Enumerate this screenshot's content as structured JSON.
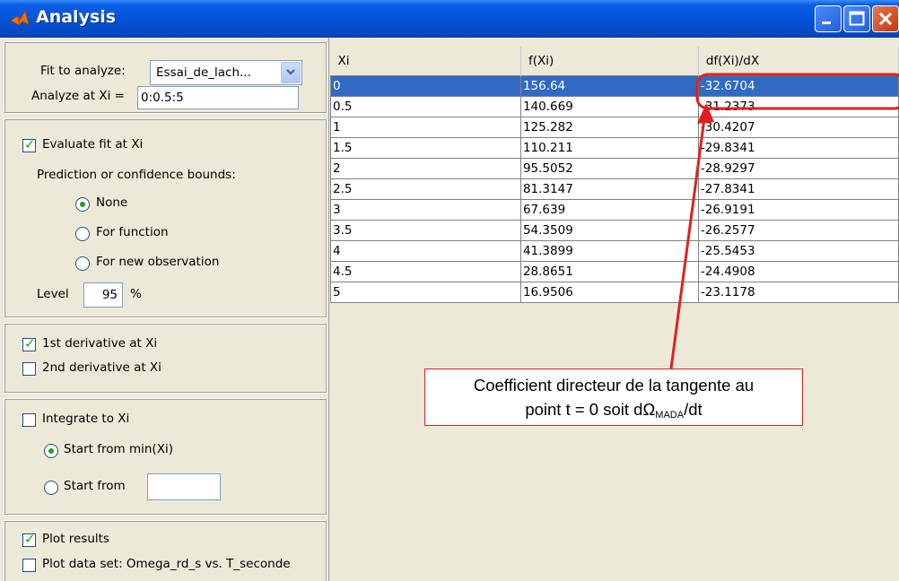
{
  "window": {
    "title": "Analysis"
  },
  "fit": {
    "fit_label": "Fit to analyze:",
    "fit_value": "Essai_de_lach...",
    "analyze_label": "Analyze at Xi =",
    "analyze_value": "0:0.5:5"
  },
  "evaluate": {
    "evaluate_label": "Evaluate fit at Xi",
    "evaluate_checked": true,
    "bounds_label": "Prediction or confidence bounds:",
    "options": [
      "None",
      "For function",
      "For new observation"
    ],
    "selected_option": "None",
    "level_label": "Level",
    "level_value": "95",
    "level_unit": "%"
  },
  "derivatives": {
    "first_label": "1st derivative at Xi",
    "first_checked": true,
    "second_label": "2nd derivative at Xi",
    "second_checked": false
  },
  "integrate": {
    "integrate_label": "Integrate to Xi",
    "integrate_checked": false,
    "start_min_label": "Start from min(Xi)",
    "start_from_label": "Start from",
    "start_from_value": ""
  },
  "plot": {
    "plot_results_label": "Plot results",
    "plot_results_checked": true,
    "plot_data_label": "Plot data set: Omega_rd_s vs. T_seconde",
    "plot_data_checked": false
  },
  "table": {
    "headers": [
      "Xi",
      "f(Xi)",
      "df(Xi)/dX"
    ],
    "rows": [
      [
        "0",
        "156.64",
        "-32.6704"
      ],
      [
        "0.5",
        "140.669",
        "-31.2373"
      ],
      [
        "1",
        "125.282",
        "-30.4207"
      ],
      [
        "1.5",
        "110.211",
        "-29.8341"
      ],
      [
        "2",
        "95.5052",
        "-28.9297"
      ],
      [
        "2.5",
        "81.3147",
        "-27.8341"
      ],
      [
        "3",
        "67.639",
        "-26.9191"
      ],
      [
        "3.5",
        "54.3509",
        "-26.2577"
      ],
      [
        "4",
        "41.3899",
        "-25.5453"
      ],
      [
        "4.5",
        "28.8651",
        "-24.4908"
      ],
      [
        "5",
        "16.9506",
        "-23.1178"
      ]
    ],
    "selected_row": 0
  },
  "annotation": {
    "line1": "Coefficient directeur de la tangente au",
    "line2_pre": "point t = 0 soit dΩ",
    "line2_sub": "MADA",
    "line2_post": "/dt",
    "color": "#e02020"
  }
}
